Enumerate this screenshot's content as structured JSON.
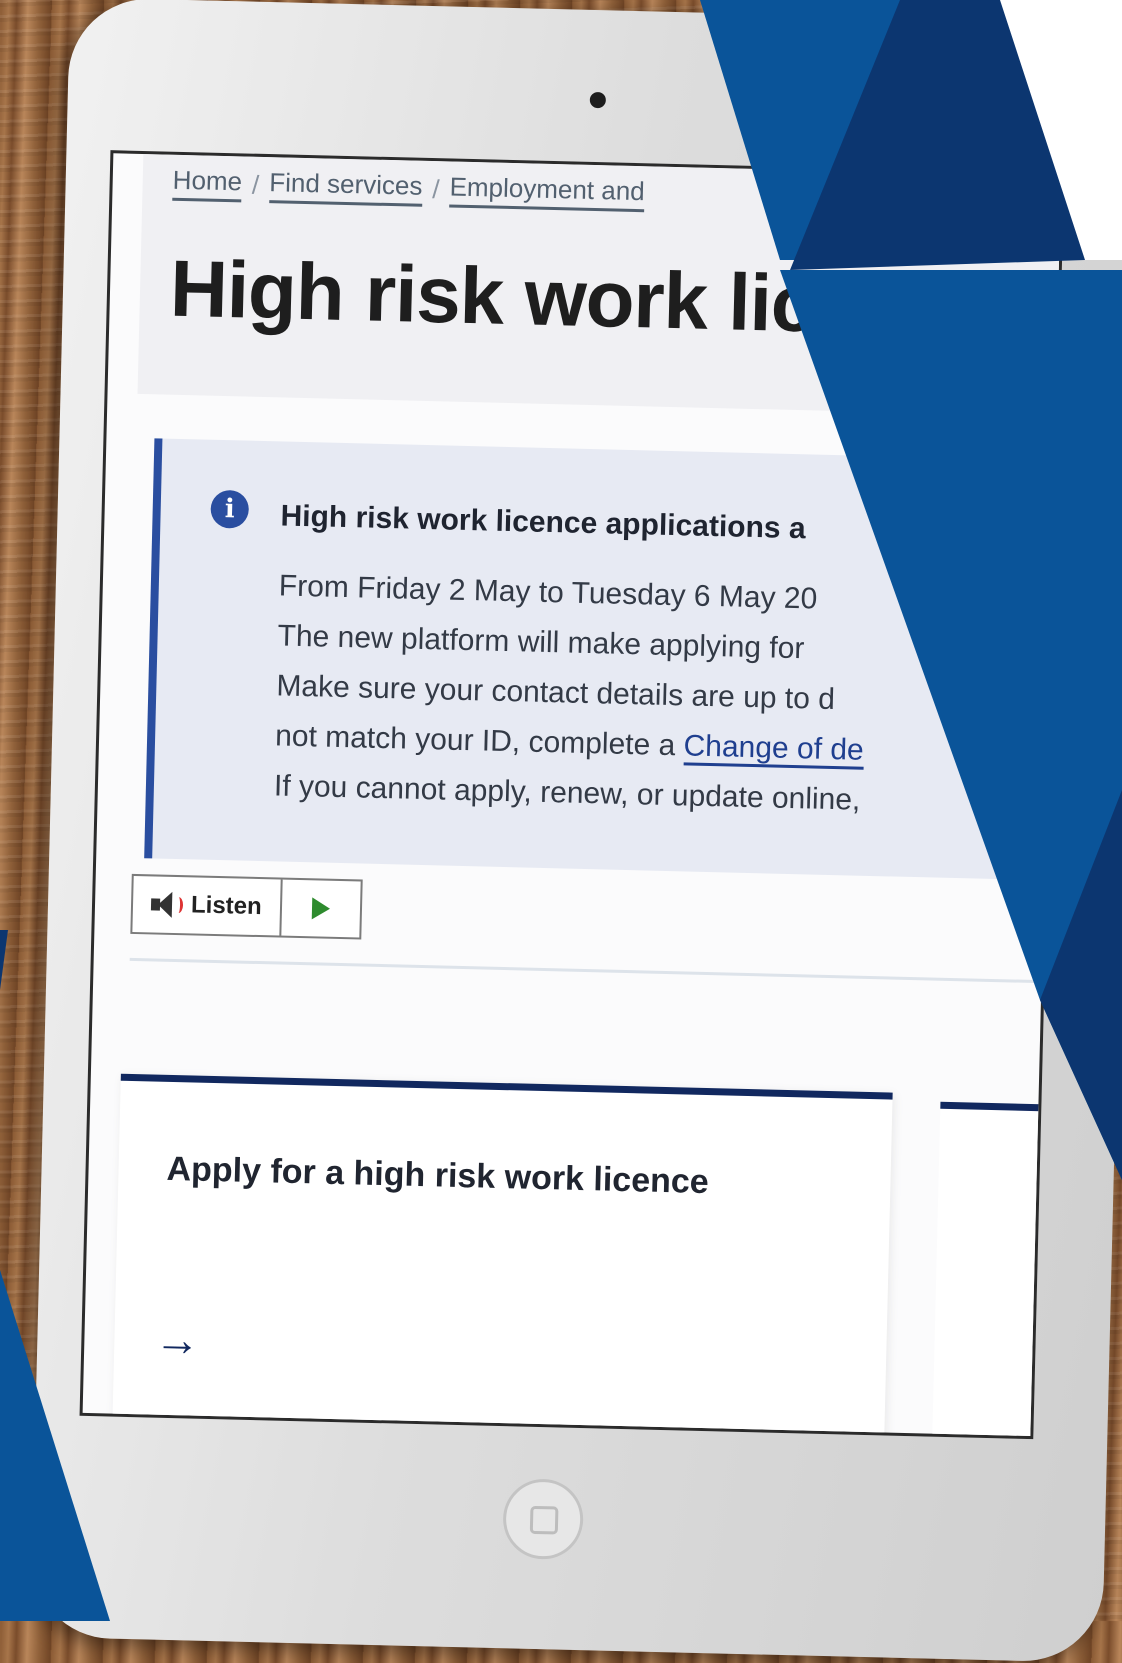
{
  "breadcrumb": {
    "items": [
      "Home",
      "Find services",
      "Employment and"
    ],
    "separator": "/"
  },
  "page": {
    "title": "High risk work lice"
  },
  "alert": {
    "icon": "info-icon",
    "heading": "High risk work licence applications a",
    "lines": [
      "From Friday 2 May to Tuesday 6 May 20",
      "The new platform will make applying for",
      "Make sure your contact details are up to d",
      "not match your ID, complete a",
      "If you cannot apply, renew, or update online,"
    ],
    "link_text": "Change of de"
  },
  "listen": {
    "label": "Listen",
    "icon": "speaker-icon",
    "play_icon": "play-icon"
  },
  "cards": [
    {
      "title": "Apply for a high risk work licence",
      "arrow": "→"
    }
  ],
  "colors": {
    "navy": "#11285f",
    "brand_blue": "#0a5499",
    "dark_blue": "#0c3670",
    "alert_bg": "#e7eaf3",
    "alert_border": "#2a4ea0"
  }
}
